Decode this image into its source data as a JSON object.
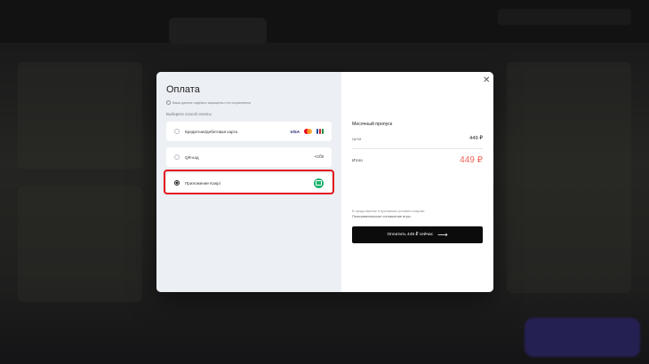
{
  "modal": {
    "title": "Оплата",
    "secure_note": "Ваши данные надёжно защищены и не сохраняются",
    "choose_label": "Выберите способ оплаты",
    "options": [
      {
        "label": "Кредитная/дебетовая карта",
        "selected": false,
        "icons": [
          "visa-logo",
          "mastercard-logo",
          "jcb-logo"
        ]
      },
      {
        "label": "QR-код",
        "selected": false,
        "icons": [
          "sbp-logo"
        ]
      },
      {
        "label": "Приложение Kaspi",
        "selected": true,
        "icons": [
          "kaspi-logo"
        ]
      }
    ],
    "visa_text": "VISA",
    "sbp_text": "≺сбп",
    "highlight_color": "#e3141e",
    "close_icon": "close-icon",
    "summary": {
      "plan": "Месячный пропуск",
      "price_label": "Цена",
      "price_value": "449 ₽",
      "total_label": "Итого",
      "total_value": "449 ₽",
      "total_color": "#f0645a"
    },
    "terms_line1": "В продолжение я принимаю условия покупки",
    "terms_line2": "Пользовательское соглашение игры",
    "pay_button": "Оплатить 449 ₽ сейчас",
    "pay_arrow": "⟶"
  }
}
